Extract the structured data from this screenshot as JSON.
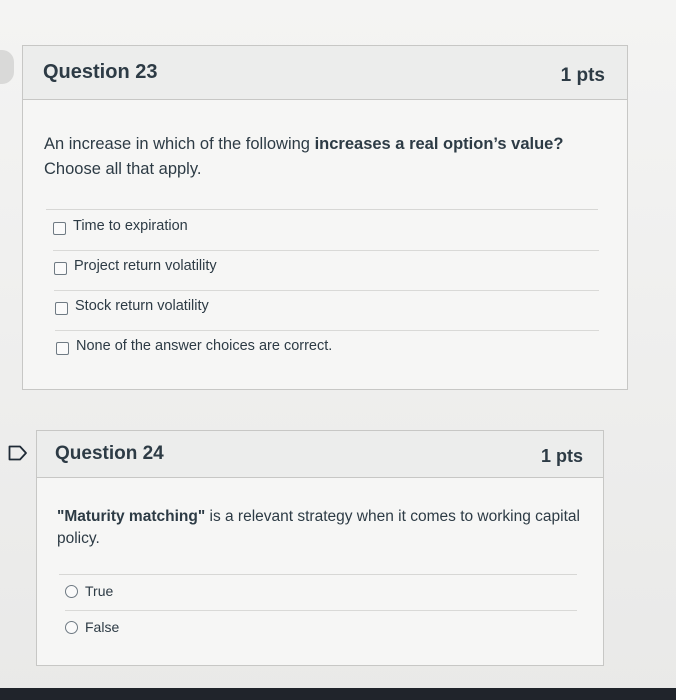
{
  "questions": [
    {
      "title": "Question 23",
      "points": "1 pts",
      "prompt_before": "An increase in which of the following ",
      "prompt_bold": "increases a real option’s value?",
      "prompt_after": "Choose all that apply.",
      "answer_type": "checkbox",
      "answers": [
        {
          "label": "Time to expiration",
          "selected": false
        },
        {
          "label": "Project return volatility",
          "selected": false
        },
        {
          "label": "Stock return volatility",
          "selected": false
        },
        {
          "label": "None of the answer choices are correct.",
          "selected": false
        }
      ]
    },
    {
      "title": "Question 24",
      "points": "1 pts",
      "prompt_bold": "\"Maturity matching\"",
      "prompt_after": " is a relevant strategy when it comes to working capital policy.",
      "answer_type": "radio",
      "flag_icon": "flag-outline-icon",
      "answers": [
        {
          "label": "True",
          "selected": false
        },
        {
          "label": "False",
          "selected": false
        }
      ]
    }
  ],
  "colors": {
    "text": "#2d3b45",
    "card_background": "#f6f6f5",
    "header_background": "#ecedec",
    "border": "#c7c7c5",
    "bottom_bar": "#20242b"
  }
}
